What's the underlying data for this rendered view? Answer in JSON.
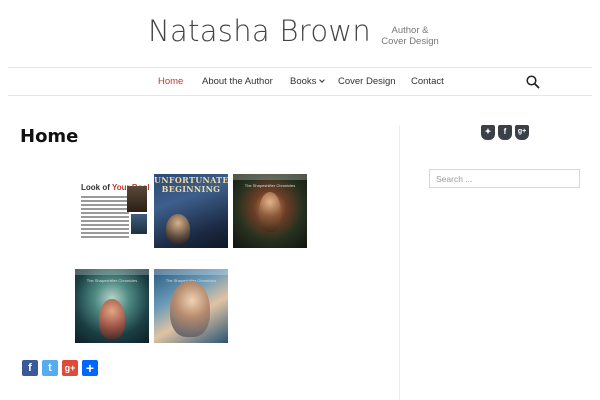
{
  "site": {
    "title": "Natasha Brown",
    "tagline_line1": "Author &",
    "tagline_line2": "Cover Design"
  },
  "nav": {
    "items": [
      {
        "label": "Home"
      },
      {
        "label": "About the Author"
      },
      {
        "label": "Books"
      },
      {
        "label": "Cover Design"
      },
      {
        "label": "Contact"
      }
    ],
    "active": "Home",
    "search_icon": "search-icon"
  },
  "main": {
    "page_title": "Home",
    "gallery": [
      {
        "type": "flyer",
        "title_prefix": "Look of ",
        "title_accent": "Your Book"
      },
      {
        "type": "cover",
        "heading_line1": "UNFORTUNATE",
        "heading_line2": "BEGINNING"
      },
      {
        "type": "cover",
        "subtitle": "The Shapeshifter Chronicles"
      },
      {
        "type": "cover",
        "subtitle": "The Shapeshifter Chronicles"
      },
      {
        "type": "cover",
        "subtitle": "The Shapeshifter Chronicles"
      }
    ],
    "share_buttons": [
      {
        "icon": "facebook-icon",
        "glyph": "f",
        "color": "#3b5998"
      },
      {
        "icon": "twitter-icon",
        "glyph": "t",
        "color": "#55acee"
      },
      {
        "icon": "google-plus-icon",
        "glyph": "g+",
        "color": "#dd4b39"
      },
      {
        "icon": "share-plus-icon",
        "glyph": "+",
        "color": "#0166ff"
      }
    ]
  },
  "sidebar": {
    "social_icons": [
      {
        "icon": "bookmark-icon",
        "glyph": "✦"
      },
      {
        "icon": "facebook-icon",
        "glyph": "f"
      },
      {
        "icon": "google-plus-icon",
        "glyph": "g+"
      }
    ],
    "search_placeholder": "Search ..."
  },
  "colors": {
    "accent": "#c0392b",
    "social_dark": "#3b3f48"
  }
}
